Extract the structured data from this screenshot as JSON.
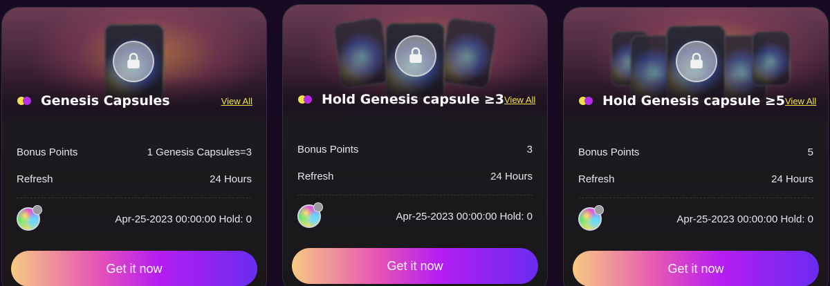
{
  "cards": [
    {
      "title": "Genesis Capsules",
      "view_all": "View All",
      "bonus_label": "Bonus Points",
      "bonus_value": "1 Genesis Capsules=3",
      "refresh_label": "Refresh",
      "refresh_value": "24 Hours",
      "hold_text": "Apr-25-2023 00:00:00 Hold: 0",
      "button": "Get it now"
    },
    {
      "title": "Hold Genesis capsule ≥3",
      "view_all": "View All",
      "bonus_label": "Bonus Points",
      "bonus_value": "3",
      "refresh_label": "Refresh",
      "refresh_value": "24 Hours",
      "hold_text": "Apr-25-2023 00:00:00 Hold: 0",
      "button": "Get it now"
    },
    {
      "title": "Hold Genesis capsule ≥5",
      "view_all": "View All",
      "bonus_label": "Bonus Points",
      "bonus_value": "5",
      "refresh_label": "Refresh",
      "refresh_value": "24 Hours",
      "hold_text": "Apr-25-2023 00:00:00 Hold: 0",
      "button": "Get it now"
    }
  ],
  "colors": {
    "accent_yellow": "#f4e545",
    "dot_purple": "#b52ee8",
    "button_gradient_start": "#f6c982",
    "button_gradient_end": "#6a2cf0"
  },
  "icons": [
    "lock-icon",
    "status-dots-icon",
    "capsule-avatar-icon"
  ]
}
